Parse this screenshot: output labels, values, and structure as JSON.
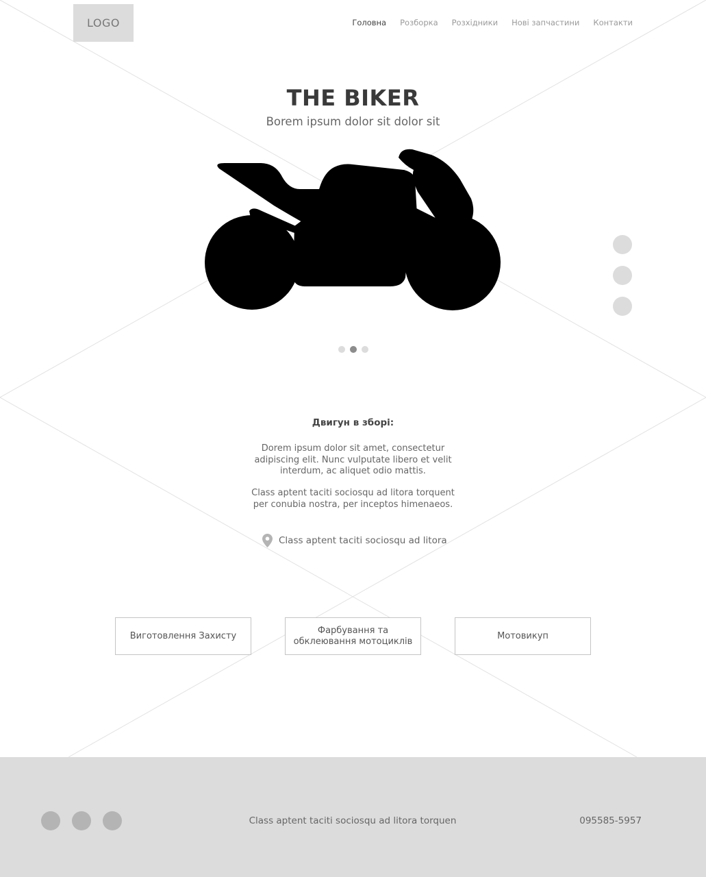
{
  "header": {
    "logo": "LOGO",
    "nav": [
      "Головна",
      "Розборка",
      "Розхідники",
      "Нові запчастини",
      "Контакти"
    ],
    "active_nav": "Головна"
  },
  "hero": {
    "title": "THE BIKER",
    "subtitle": "Borem ipsum dolor sit dolor sit",
    "image_icon": "motorcycle-icon",
    "carousel": {
      "total": 3,
      "active": 2
    },
    "side_dots": 3
  },
  "info": {
    "heading": "Двигун в зборі:",
    "paragraph1": "Dorem ipsum dolor sit amet, consectetur adipiscing elit. Nunc vulputate libero et velit interdum, ac aliquet odio mattis.",
    "paragraph2": "Class aptent taciti sociosqu ad litora torquent per conubia nostra, per inceptos himenaeos.",
    "location_icon": "location-pin-icon",
    "location": "Class aptent taciti sociosqu ad litora"
  },
  "services": [
    "Виготовлення Захисту",
    "Фарбування та обклеювання мотоциклів",
    "Мотовикуп"
  ],
  "footer": {
    "social_icons": [
      "social-icon-1",
      "social-icon-2",
      "social-icon-3"
    ],
    "text": "Class aptent taciti sociosqu ad litora torquen",
    "phone": "095585-5957"
  },
  "colors": {
    "placeholder_gray": "#dcdcdc",
    "footer_bg": "#dcdcdc",
    "social_circle": "#b4b4b4",
    "text_dark": "#444444",
    "active_dot": "#8c8c8c"
  }
}
